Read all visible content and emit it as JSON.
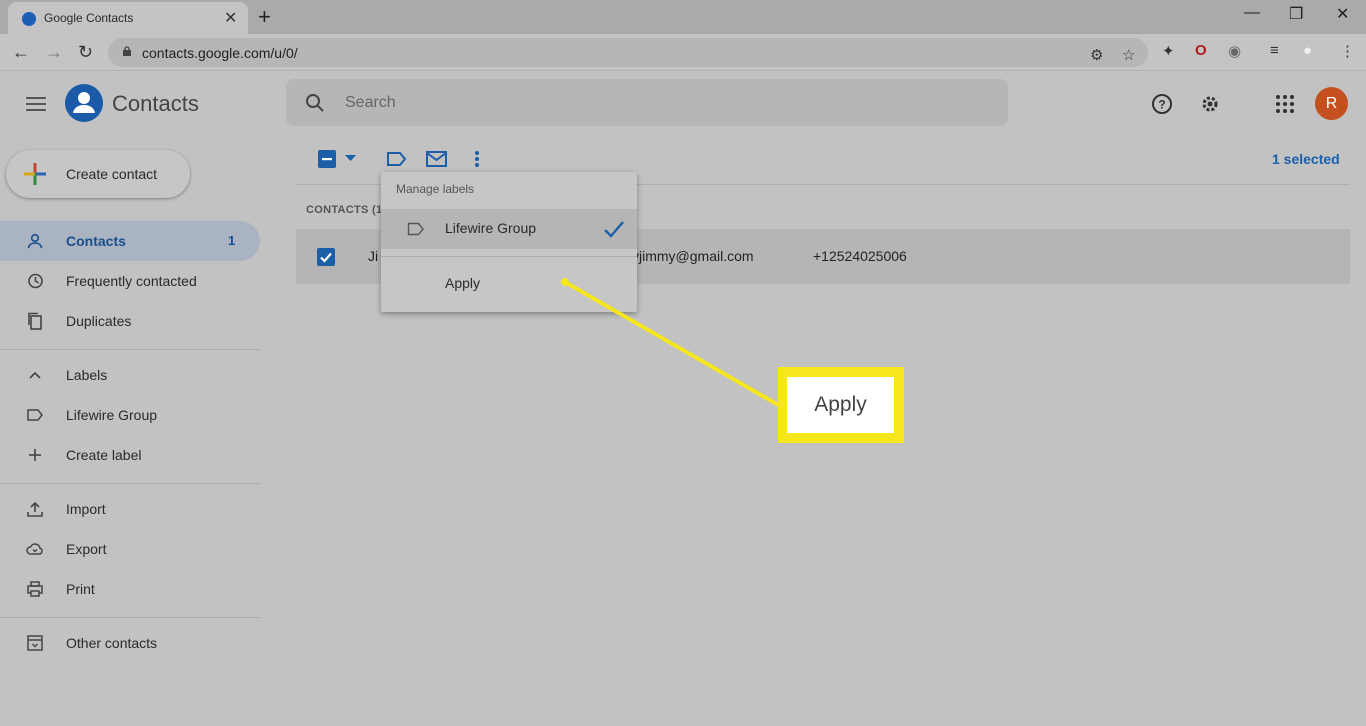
{
  "browser": {
    "tab_title": "Google Contacts",
    "tab_close": "✕",
    "new_tab": "+",
    "url": "contacts.google.com/u/0/",
    "window_controls": [
      "—",
      "❐",
      "✕"
    ]
  },
  "header": {
    "app_name": "Contacts",
    "search_placeholder": "Search",
    "avatar_initial": "R"
  },
  "sidebar": {
    "create_button": "Create contact",
    "items": [
      {
        "label": "Contacts",
        "count": "1",
        "icon": "person-icon",
        "active": true
      },
      {
        "label": "Frequently contacted",
        "icon": "history-icon"
      },
      {
        "label": "Duplicates",
        "icon": "copy-icon"
      }
    ],
    "labels_section": {
      "header": "Labels",
      "items": [
        {
          "label": "Lifewire Group",
          "icon": "label-icon"
        },
        {
          "label": "Create label",
          "icon": "plus-icon"
        }
      ]
    },
    "tools": [
      {
        "label": "Import",
        "icon": "upload-icon"
      },
      {
        "label": "Export",
        "icon": "cloud-download-icon"
      },
      {
        "label": "Print",
        "icon": "printer-icon"
      }
    ],
    "other": {
      "label": "Other contacts",
      "icon": "archive-icon"
    }
  },
  "toolbar": {
    "selected_count": "1 selected"
  },
  "contacts_list": {
    "header": "CONTACTS (1",
    "rows": [
      {
        "name": "Ji",
        "email": "yjimmy@gmail.com",
        "phone": "+12524025006",
        "checked": true
      }
    ]
  },
  "dropdown": {
    "title": "Manage labels",
    "labels": [
      {
        "name": "Lifewire Group",
        "checked": true
      }
    ],
    "apply": "Apply"
  },
  "callout": {
    "text": "Apply",
    "color": "#f5e71c"
  },
  "colors": {
    "accent": "#1a5fa8",
    "avatar": "#c4501f",
    "highlight": "#f5e71c"
  }
}
